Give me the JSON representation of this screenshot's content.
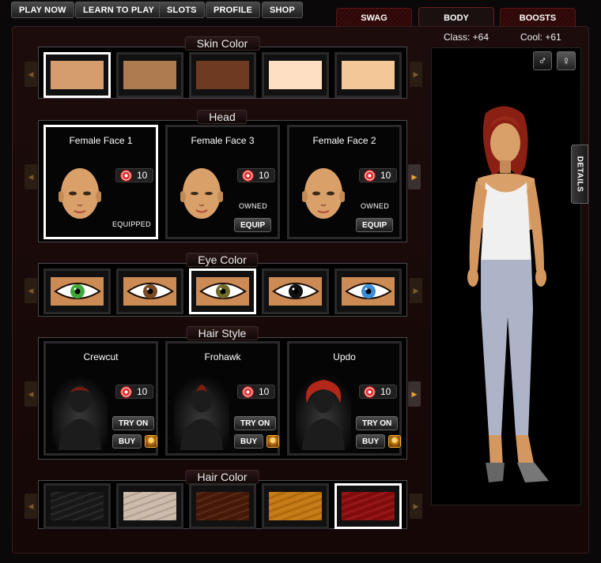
{
  "nav": [
    "PLAY NOW",
    "LEARN TO PLAY",
    "SLOTS",
    "PROFILE",
    "SHOP"
  ],
  "tabs": {
    "swag": "SWAG",
    "body": "BODY",
    "boosts": "BOOSTS"
  },
  "stats": {
    "class": "Class: +64",
    "cool": "Cool: +61"
  },
  "sections": {
    "skin": "Skin Color",
    "head": "Head",
    "eye": "Eye Color",
    "hair_style": "Hair Style",
    "hair_color": "Hair Color"
  },
  "skin_colors": [
    "#d59c6e",
    "#ae7a50",
    "#6e3a22",
    "#ffdfc3",
    "#f4c799"
  ],
  "head": [
    {
      "name": "Female Face 1",
      "price": "10",
      "status": "EQUIPPED",
      "button": ""
    },
    {
      "name": "Female Face 3",
      "price": "10",
      "status": "OWNED",
      "button": "EQUIP"
    },
    {
      "name": "Female Face 2",
      "price": "10",
      "status": "OWNED",
      "button": "EQUIP"
    }
  ],
  "eye_colors": [
    "#3ea83a",
    "#7a4a22",
    "#6f6a2a",
    "#111111",
    "#3a8ed8"
  ],
  "hair_styles": [
    {
      "name": "Crewcut",
      "price": "10",
      "try": "TRY ON",
      "buy": "BUY"
    },
    {
      "name": "Frohawk",
      "price": "10",
      "try": "TRY ON",
      "buy": "BUY"
    },
    {
      "name": "Updo",
      "price": "10",
      "try": "TRY ON",
      "buy": "BUY"
    }
  ],
  "hair_colors": [
    "#1a1a1a",
    "#cbb8a8",
    "#4a1a08",
    "#c27710",
    "#8c0d0d"
  ],
  "gender": {
    "male": "♂",
    "female": "♀"
  },
  "details": "DETAILS"
}
